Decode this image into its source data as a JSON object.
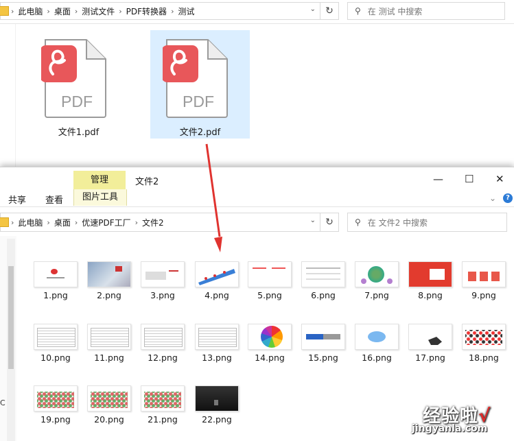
{
  "top_window": {
    "breadcrumbs": [
      "此电脑",
      "桌面",
      "测试文件",
      "PDF转换器",
      "测试"
    ],
    "search_placeholder": "在 测试 中搜索",
    "files": [
      {
        "name": "文件1.pdf",
        "icon_text": "PDF",
        "selected": false
      },
      {
        "name": "文件2.pdf",
        "icon_text": "PDF",
        "selected": true
      }
    ]
  },
  "bottom_window": {
    "title": "文件2",
    "ribbon_tabs": [
      "共享",
      "查看"
    ],
    "contextual_tab_group": "管理",
    "contextual_tab": "图片工具",
    "breadcrumbs": [
      "此电脑",
      "桌面",
      "优速PDF工厂",
      "文件2"
    ],
    "search_placeholder": "在 文件2 中搜索",
    "side_label": "C",
    "files": [
      "1.png",
      "2.png",
      "3.png",
      "4.png",
      "5.png",
      "6.png",
      "7.png",
      "8.png",
      "9.png",
      "10.png",
      "11.png",
      "12.png",
      "13.png",
      "14.png",
      "15.png",
      "16.png",
      "17.png",
      "18.png",
      "19.png",
      "20.png",
      "21.png",
      "22.png"
    ]
  },
  "watermark": {
    "line1": "经验啦",
    "check": "√",
    "line2": "jingyanla.com"
  },
  "colors": {
    "pdf_red": "#e8575a",
    "selection": "#dbeeff",
    "manage_tab": "#f2ee9a",
    "arrow": "#e0332f"
  }
}
